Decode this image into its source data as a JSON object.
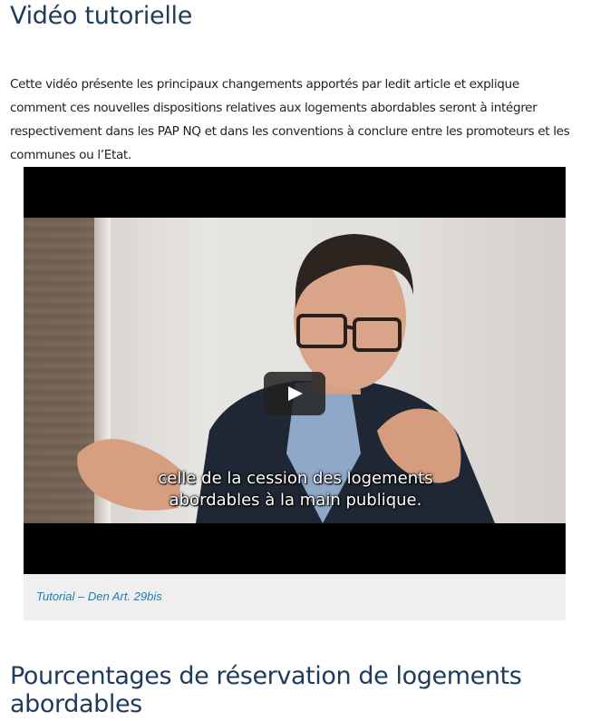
{
  "section": {
    "title": "Vidéo tutorielle",
    "intro": "Cette vidéo présente les principaux changements apportés par ledit article et explique comment ces nouvelles dispositions relatives aux logements abordables seront à intégrer respectivement dans les PAP NQ et dans les conventions à conclure entre les promoteurs et les communes ou l’Etat."
  },
  "video": {
    "subtitle_line1": "celle de la cession des logements",
    "subtitle_line2": "abordables à la main publique.",
    "play_icon": "play-icon",
    "caption": "Tutorial – Den Art. 29bis"
  },
  "next_section": {
    "title": "Pourcentages de réservation de logements abordables"
  },
  "colors": {
    "heading": "#1f3b5c",
    "caption": "#1b7fb3",
    "caption_bg": "#efefef"
  }
}
